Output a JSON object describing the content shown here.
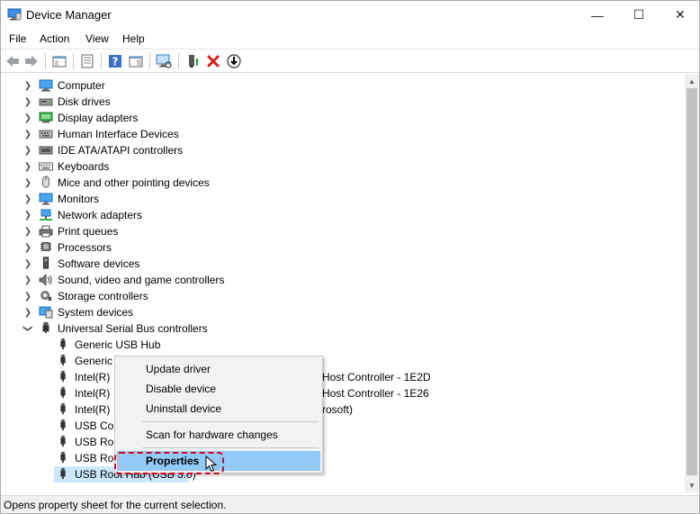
{
  "window": {
    "title": "Device Manager",
    "controls": {
      "minimize": "—",
      "maximize": "☐",
      "close": "✕"
    }
  },
  "menubar": {
    "items": [
      "File",
      "Action",
      "View",
      "Help"
    ]
  },
  "toolbar": {
    "icons": [
      "back-arrow-icon",
      "forward-arrow-icon",
      "show-hide-console-tree-icon",
      "properties-icon",
      "help-icon",
      "action-pane-icon",
      "scan-hardware-icon",
      "update-driver-icon",
      "uninstall-icon",
      "disable-device-icon"
    ]
  },
  "tree": {
    "categories": [
      {
        "label": "Computer",
        "expanded": false,
        "icon": "computer-icon"
      },
      {
        "label": "Disk drives",
        "expanded": false,
        "icon": "disk-drive-icon"
      },
      {
        "label": "Display adapters",
        "expanded": false,
        "icon": "display-adapter-icon"
      },
      {
        "label": "Human Interface Devices",
        "expanded": false,
        "icon": "hid-icon"
      },
      {
        "label": "IDE ATA/ATAPI controllers",
        "expanded": false,
        "icon": "ide-controller-icon"
      },
      {
        "label": "Keyboards",
        "expanded": false,
        "icon": "keyboard-icon"
      },
      {
        "label": "Mice and other pointing devices",
        "expanded": false,
        "icon": "mouse-icon"
      },
      {
        "label": "Monitors",
        "expanded": false,
        "icon": "monitor-icon"
      },
      {
        "label": "Network adapters",
        "expanded": false,
        "icon": "network-adapter-icon"
      },
      {
        "label": "Print queues",
        "expanded": false,
        "icon": "printer-icon"
      },
      {
        "label": "Processors",
        "expanded": false,
        "icon": "processor-icon"
      },
      {
        "label": "Software devices",
        "expanded": false,
        "icon": "software-device-icon"
      },
      {
        "label": "Sound, video and game controllers",
        "expanded": false,
        "icon": "sound-icon"
      },
      {
        "label": "Storage controllers",
        "expanded": false,
        "icon": "storage-controller-icon"
      },
      {
        "label": "System devices",
        "expanded": false,
        "icon": "system-device-icon"
      },
      {
        "label": "Universal Serial Bus controllers",
        "expanded": true,
        "icon": "usb-icon"
      }
    ],
    "usb_children": [
      {
        "label": "Generic USB Hub"
      },
      {
        "label": "Generic"
      },
      {
        "label": "Intel(R)",
        "suffix": "Host Controller - 1E2D"
      },
      {
        "label": "Intel(R)",
        "suffix": "Host Controller - 1E26"
      },
      {
        "label": "Intel(R)",
        "suffix": "rosoft)"
      },
      {
        "label": "USB Cor"
      },
      {
        "label": "USB Roo"
      },
      {
        "label": "USB Roo"
      },
      {
        "label": "USB Root Hub (USB 3.0)",
        "selected": true
      }
    ]
  },
  "context_menu": {
    "items": [
      "Update driver",
      "Disable device",
      "Uninstall device"
    ],
    "scan": "Scan for hardware changes",
    "properties": "Properties"
  },
  "statusbar": {
    "text": "Opens property sheet for the current selection."
  },
  "colors": {
    "selection": "#cce8ff",
    "menu_highlight": "#91c9f7",
    "annotation_red": "#e0001b"
  }
}
